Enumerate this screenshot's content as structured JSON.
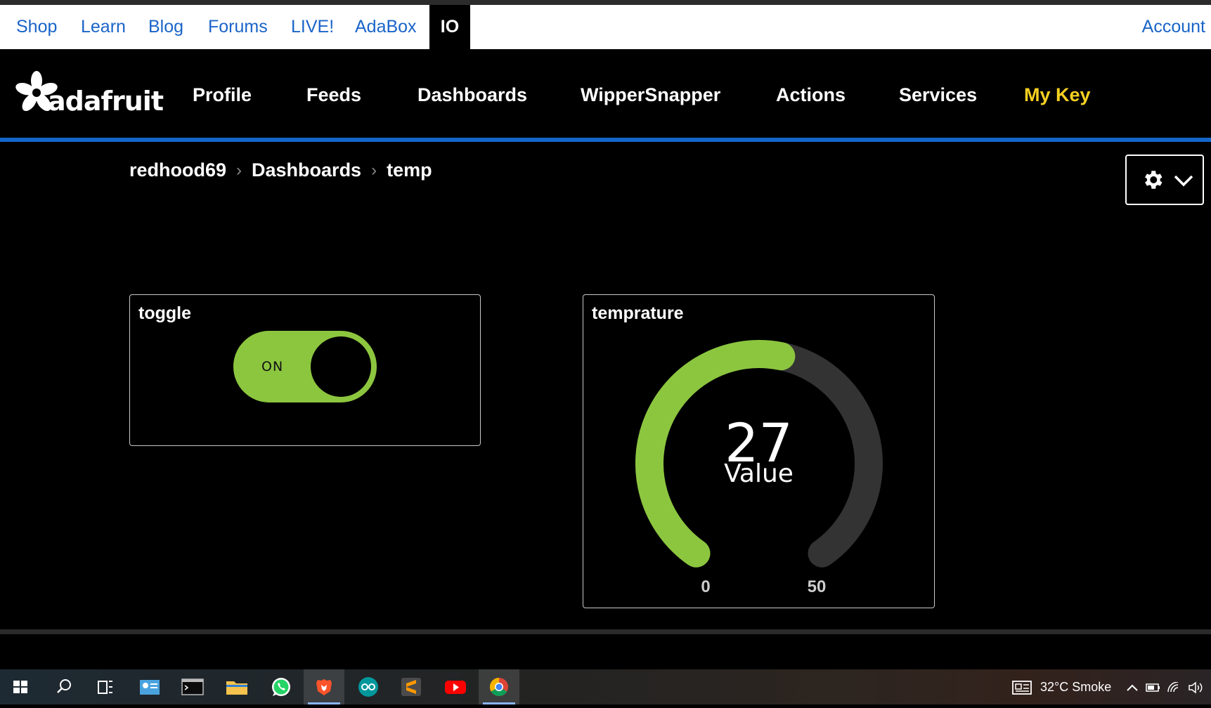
{
  "top_nav": {
    "items": [
      {
        "label": "Shop"
      },
      {
        "label": "Learn"
      },
      {
        "label": "Blog"
      },
      {
        "label": "Forums"
      },
      {
        "label": "LIVE!"
      },
      {
        "label": "AdaBox"
      },
      {
        "label": "IO",
        "active": true
      }
    ],
    "account_label": "Account",
    "link_color": "#1a64c8"
  },
  "main_nav": {
    "logo_text": "adafruit",
    "items": [
      "Profile",
      "Feeds",
      "Dashboards",
      "WipperSnapper",
      "Actions",
      "Services"
    ],
    "key_label": "My Key",
    "key_color": "#f5d020",
    "accent_rule_color": "#1465c8"
  },
  "breadcrumb": [
    "redhood69",
    "Dashboards",
    "temp"
  ],
  "settings_button": {
    "icons": [
      "gear-icon",
      "chevron-down-icon"
    ]
  },
  "blocks": {
    "toggle": {
      "title": "toggle",
      "state_label": "ON",
      "state": true,
      "color": "#8cc63f"
    },
    "gauge": {
      "title": "temprature",
      "value": "27",
      "value_label": "Value",
      "min": "0",
      "max": "50",
      "fraction": 0.54,
      "fill_color": "#8cc63f",
      "track_color": "#333333"
    }
  },
  "taskbar": {
    "apps": [
      "windows-start-icon",
      "search-icon",
      "task-view-icon",
      "contacts-icon",
      "terminal-icon",
      "file-explorer-icon",
      "whatsapp-icon",
      "brave-icon",
      "arduino-icon",
      "sublime-icon",
      "youtube-icon",
      "chrome-icon"
    ],
    "weather": "32°C  Smoke",
    "tray_icons": [
      "news-icon",
      "chevron-up-icon",
      "battery-icon",
      "wifi-icon",
      "speaker-icon"
    ]
  }
}
